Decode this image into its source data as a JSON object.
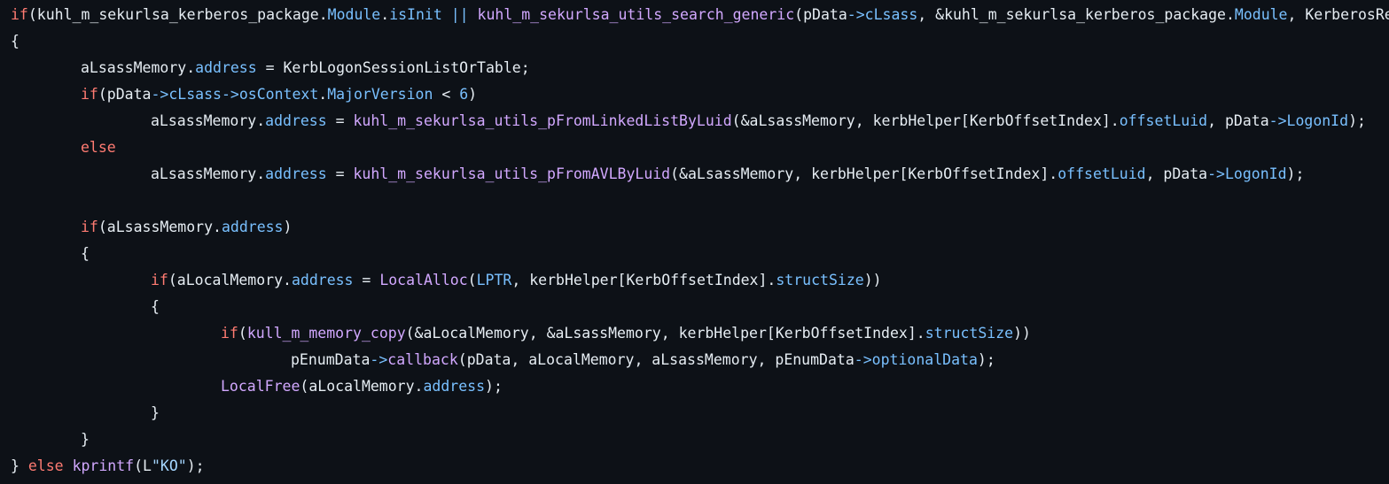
{
  "code": {
    "language": "c",
    "lines": [
      {
        "indent": 0,
        "tokens": [
          {
            "t": "kw",
            "v": "if"
          },
          {
            "t": "plain",
            "v": "(kuhl_m_sekurlsa_kerberos_package."
          },
          {
            "t": "prop",
            "v": "Module"
          },
          {
            "t": "plain",
            "v": "."
          },
          {
            "t": "prop",
            "v": "isInit"
          },
          {
            "t": "plain",
            "v": " "
          },
          {
            "t": "prop",
            "v": "||"
          },
          {
            "t": "plain",
            "v": " "
          },
          {
            "t": "fn",
            "v": "kuhl_m_sekurlsa_utils_search_generic"
          },
          {
            "t": "plain",
            "v": "(pData"
          },
          {
            "t": "prop",
            "v": "->"
          },
          {
            "t": "prop",
            "v": "cLsass"
          },
          {
            "t": "plain",
            "v": ", &kuhl_m_sekurlsa_kerberos_package."
          },
          {
            "t": "prop",
            "v": "Module"
          },
          {
            "t": "plain",
            "v": ", KerberosReference"
          }
        ]
      },
      {
        "indent": 0,
        "tokens": [
          {
            "t": "plain",
            "v": "{"
          }
        ]
      },
      {
        "indent": 1,
        "tokens": [
          {
            "t": "plain",
            "v": "aLsassMemory."
          },
          {
            "t": "prop",
            "v": "address"
          },
          {
            "t": "plain",
            "v": " = KerbLogonSessionListOrTable;"
          }
        ]
      },
      {
        "indent": 1,
        "tokens": [
          {
            "t": "kw",
            "v": "if"
          },
          {
            "t": "plain",
            "v": "(pData"
          },
          {
            "t": "prop",
            "v": "->"
          },
          {
            "t": "prop",
            "v": "cLsass"
          },
          {
            "t": "prop",
            "v": "->"
          },
          {
            "t": "prop",
            "v": "osContext"
          },
          {
            "t": "plain",
            "v": "."
          },
          {
            "t": "prop",
            "v": "MajorVersion"
          },
          {
            "t": "plain",
            "v": " < "
          },
          {
            "t": "num",
            "v": "6"
          },
          {
            "t": "plain",
            "v": ")"
          }
        ]
      },
      {
        "indent": 2,
        "tokens": [
          {
            "t": "plain",
            "v": "aLsassMemory."
          },
          {
            "t": "prop",
            "v": "address"
          },
          {
            "t": "plain",
            "v": " = "
          },
          {
            "t": "fn",
            "v": "kuhl_m_sekurlsa_utils_pFromLinkedListByLuid"
          },
          {
            "t": "plain",
            "v": "(&aLsassMemory, kerbHelper[KerbOffsetIndex]."
          },
          {
            "t": "prop",
            "v": "offsetLuid"
          },
          {
            "t": "plain",
            "v": ", pData"
          },
          {
            "t": "prop",
            "v": "->"
          },
          {
            "t": "prop",
            "v": "LogonId"
          },
          {
            "t": "plain",
            "v": ");"
          }
        ]
      },
      {
        "indent": 1,
        "tokens": [
          {
            "t": "kw",
            "v": "else"
          }
        ]
      },
      {
        "indent": 2,
        "tokens": [
          {
            "t": "plain",
            "v": "aLsassMemory."
          },
          {
            "t": "prop",
            "v": "address"
          },
          {
            "t": "plain",
            "v": " = "
          },
          {
            "t": "fn",
            "v": "kuhl_m_sekurlsa_utils_pFromAVLByLuid"
          },
          {
            "t": "plain",
            "v": "(&aLsassMemory, kerbHelper[KerbOffsetIndex]."
          },
          {
            "t": "prop",
            "v": "offsetLuid"
          },
          {
            "t": "plain",
            "v": ", pData"
          },
          {
            "t": "prop",
            "v": "->"
          },
          {
            "t": "prop",
            "v": "LogonId"
          },
          {
            "t": "plain",
            "v": ");"
          }
        ]
      },
      {
        "indent": 0,
        "tokens": []
      },
      {
        "indent": 1,
        "tokens": [
          {
            "t": "kw",
            "v": "if"
          },
          {
            "t": "plain",
            "v": "(aLsassMemory."
          },
          {
            "t": "prop",
            "v": "address"
          },
          {
            "t": "plain",
            "v": ")"
          }
        ]
      },
      {
        "indent": 1,
        "tokens": [
          {
            "t": "plain",
            "v": "{"
          }
        ]
      },
      {
        "indent": 2,
        "tokens": [
          {
            "t": "kw",
            "v": "if"
          },
          {
            "t": "plain",
            "v": "(aLocalMemory."
          },
          {
            "t": "prop",
            "v": "address"
          },
          {
            "t": "plain",
            "v": " = "
          },
          {
            "t": "fn",
            "v": "LocalAlloc"
          },
          {
            "t": "plain",
            "v": "("
          },
          {
            "t": "prop",
            "v": "LPTR"
          },
          {
            "t": "plain",
            "v": ", kerbHelper[KerbOffsetIndex]."
          },
          {
            "t": "prop",
            "v": "structSize"
          },
          {
            "t": "plain",
            "v": "))"
          }
        ]
      },
      {
        "indent": 2,
        "tokens": [
          {
            "t": "plain",
            "v": "{"
          }
        ]
      },
      {
        "indent": 3,
        "tokens": [
          {
            "t": "kw",
            "v": "if"
          },
          {
            "t": "plain",
            "v": "("
          },
          {
            "t": "fn",
            "v": "kull_m_memory_copy"
          },
          {
            "t": "plain",
            "v": "(&aLocalMemory, &aLsassMemory, kerbHelper[KerbOffsetIndex]."
          },
          {
            "t": "prop",
            "v": "structSize"
          },
          {
            "t": "plain",
            "v": "))"
          }
        ]
      },
      {
        "indent": 4,
        "tokens": [
          {
            "t": "plain",
            "v": "pEnumData"
          },
          {
            "t": "prop",
            "v": "->"
          },
          {
            "t": "fn",
            "v": "callback"
          },
          {
            "t": "plain",
            "v": "(pData, aLocalMemory, aLsassMemory, pEnumData"
          },
          {
            "t": "prop",
            "v": "->"
          },
          {
            "t": "prop",
            "v": "optionalData"
          },
          {
            "t": "plain",
            "v": ");"
          }
        ]
      },
      {
        "indent": 3,
        "tokens": [
          {
            "t": "fn",
            "v": "LocalFree"
          },
          {
            "t": "plain",
            "v": "(aLocalMemory."
          },
          {
            "t": "prop",
            "v": "address"
          },
          {
            "t": "plain",
            "v": ");"
          }
        ]
      },
      {
        "indent": 2,
        "tokens": [
          {
            "t": "plain",
            "v": "}"
          }
        ]
      },
      {
        "indent": 1,
        "tokens": [
          {
            "t": "plain",
            "v": "}"
          }
        ]
      },
      {
        "indent": 0,
        "tokens": [
          {
            "t": "plain",
            "v": "} "
          },
          {
            "t": "kw",
            "v": "else"
          },
          {
            "t": "plain",
            "v": " "
          },
          {
            "t": "fn",
            "v": "kprintf"
          },
          {
            "t": "plain",
            "v": "(L"
          },
          {
            "t": "str",
            "v": "\"KO\""
          },
          {
            "t": "plain",
            "v": ");"
          }
        ]
      }
    ]
  },
  "colors": {
    "background": "#0d1117",
    "text": "#e6edf3",
    "keyword": "#ff7b72",
    "function": "#d2a8ff",
    "property": "#79c0ff",
    "string": "#a5d6ff"
  }
}
